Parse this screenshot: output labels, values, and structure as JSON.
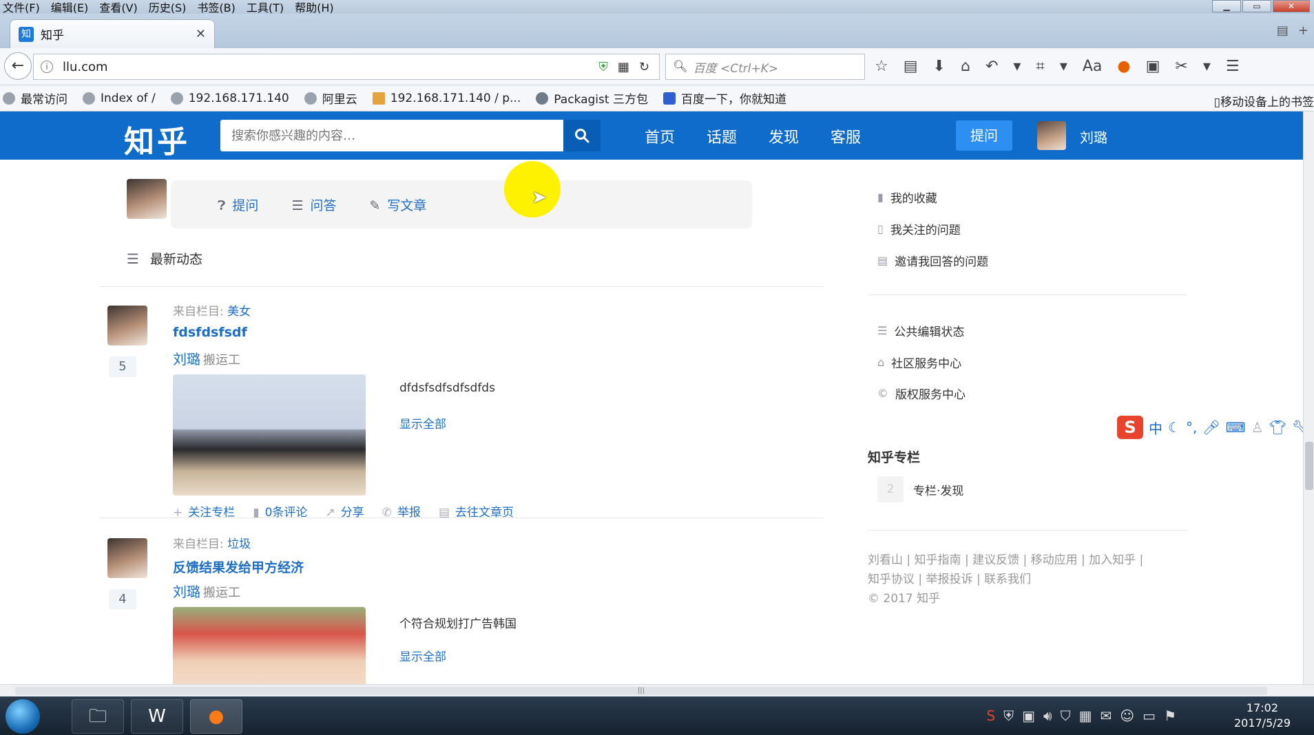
{
  "menubar": {
    "items": [
      "文件(F)",
      "编辑(E)",
      "查看(V)",
      "历史(S)",
      "书签(B)",
      "工具(T)",
      "帮助(H)"
    ]
  },
  "tab": {
    "title": "知乎",
    "favicon": "知"
  },
  "address": {
    "url": "llu.com",
    "search_placeholder": "百度 <Ctrl+K>"
  },
  "bookmarks": {
    "items": [
      "最常访问",
      "Index of /",
      "192.168.171.140",
      "阿里云",
      "192.168.171.140 / p...",
      "Packagist 三方包",
      "百度一下，你就知道"
    ],
    "mobile": "移动设备上的书签"
  },
  "zhihu": {
    "logo": "知乎",
    "search_placeholder": "搜索你感兴趣的内容…",
    "nav": [
      "首页",
      "话题",
      "发现",
      "客服"
    ],
    "ask_button": "提问",
    "user_name": "刘璐"
  },
  "compose": {
    "ask": "提问",
    "answer": "问答",
    "write": "写文章"
  },
  "feed": {
    "header": "最新动态",
    "items": [
      {
        "from_label": "来自栏目:",
        "column": "美女",
        "title": "fdsfdsfsdf",
        "author": "刘璐",
        "author_tag": "搬运工",
        "votes": "5",
        "excerpt": "dfdsfsdfsdfsdfds",
        "show_all": "显示全部",
        "actions": [
          "关注专栏",
          "0条评论",
          "分享",
          "举报",
          "去往文章页"
        ]
      },
      {
        "from_label": "来自栏目:",
        "column": "垃圾",
        "title": "反馈结果发给甲方经济",
        "author": "刘璐",
        "author_tag": "搬运工",
        "votes": "4",
        "excerpt": "个符合规划打广告韩国",
        "show_all": "显示全部"
      }
    ]
  },
  "sidebar": {
    "links_top": [
      "我的收藏",
      "我关注的问题",
      "邀请我回答的问题"
    ],
    "links_mid": [
      "公共编辑状态",
      "社区服务中心",
      "版权服务中心"
    ],
    "column_title": "知乎专栏",
    "column_count": "2",
    "column_label": "专栏·发现",
    "footer_line1": "刘看山 | 知乎指南 | 建议反馈 | 移动应用 | 加入知乎 |",
    "footer_line2": "知乎协议 | 举报投诉 | 联系我们",
    "copyright": "© 2017 知乎"
  },
  "ime": {
    "mode": "中"
  },
  "taskbar": {
    "time": "17:02",
    "date": "2017/5/29"
  }
}
